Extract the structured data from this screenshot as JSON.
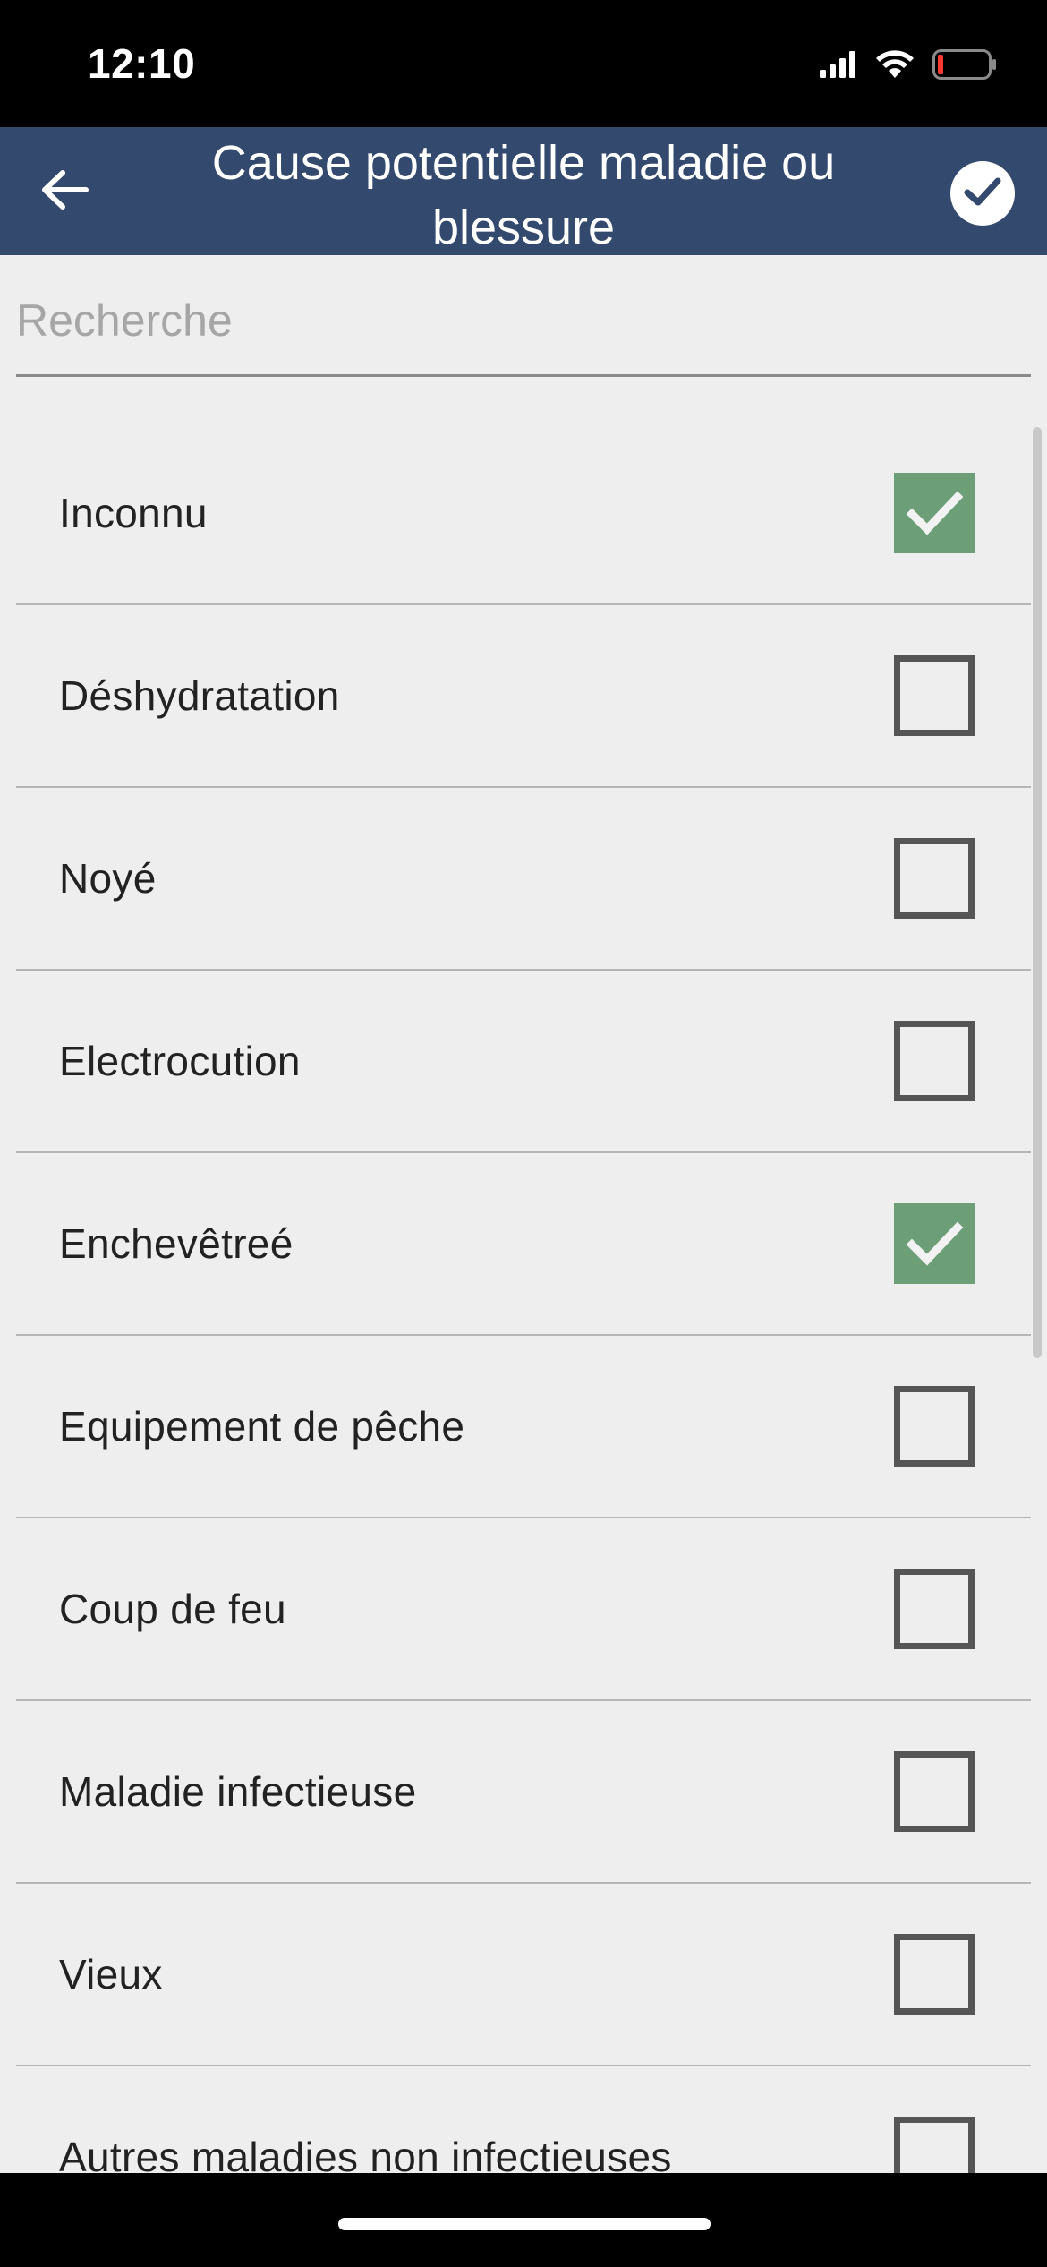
{
  "status_bar": {
    "time": "12:10",
    "icons": [
      "cellular-signal-icon",
      "wifi-icon",
      "battery-low-icon"
    ]
  },
  "header": {
    "title": "Cause potentielle maladie ou blessure",
    "back_icon": "arrow-left-icon",
    "confirm_icon": "check-circle-icon",
    "background_color": "#34496e"
  },
  "search": {
    "placeholder": "Recherche",
    "value": ""
  },
  "items": [
    {
      "label": "Inconnu",
      "checked": true
    },
    {
      "label": "Déshydratation",
      "checked": false
    },
    {
      "label": "Noyé",
      "checked": false
    },
    {
      "label": "Electrocution",
      "checked": false
    },
    {
      "label": "Enchevêtreé",
      "checked": true
    },
    {
      "label": "Equipement de pêche",
      "checked": false
    },
    {
      "label": "Coup de feu",
      "checked": false
    },
    {
      "label": "Maladie infectieuse",
      "checked": false
    },
    {
      "label": "Vieux",
      "checked": false
    },
    {
      "label": "Autres maladies non infectieuses",
      "checked": false
    }
  ],
  "colors": {
    "checked_fill": "#6c9f78",
    "unchecked_border": "#555555",
    "content_background": "#eeeeee"
  }
}
